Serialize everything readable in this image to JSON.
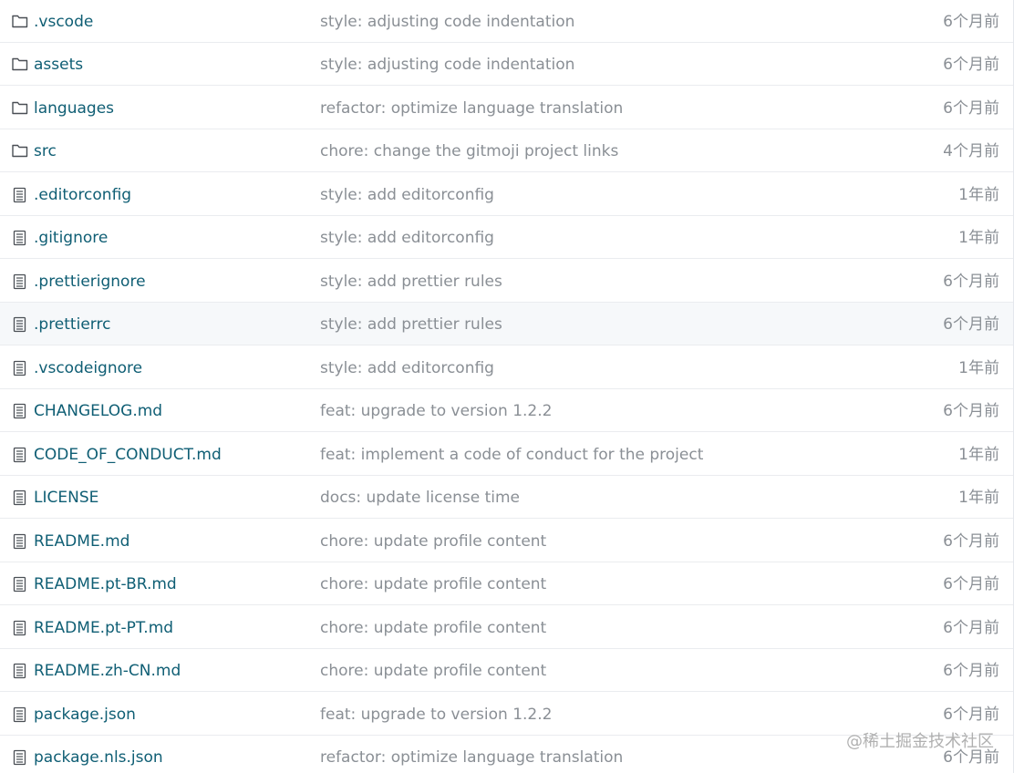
{
  "colors": {
    "file_link": "#0f5e74",
    "muted_text": "#8a8f95",
    "row_border": "#eaecef",
    "row_hover": "#f6f8fa"
  },
  "files": [
    {
      "type": "folder",
      "icon": "folder-icon",
      "name": ".vscode",
      "message": "style: adjusting code indentation",
      "time": "6个月前"
    },
    {
      "type": "folder",
      "icon": "folder-icon",
      "name": "assets",
      "message": "style: adjusting code indentation",
      "time": "6个月前"
    },
    {
      "type": "folder",
      "icon": "folder-icon",
      "name": "languages",
      "message": "refactor: optimize language translation",
      "time": "6个月前"
    },
    {
      "type": "folder",
      "icon": "folder-icon",
      "name": "src",
      "message": "chore: change the gitmoji project links",
      "time": "4个月前"
    },
    {
      "type": "file",
      "icon": "file-icon",
      "name": ".editorconfig",
      "message": "style: add editorconfig",
      "time": "1年前"
    },
    {
      "type": "file",
      "icon": "file-icon",
      "name": ".gitignore",
      "message": "style: add editorconfig",
      "time": "1年前"
    },
    {
      "type": "file",
      "icon": "file-icon",
      "name": ".prettierignore",
      "message": "style: add prettier rules",
      "time": "6个月前"
    },
    {
      "type": "file",
      "icon": "file-icon",
      "name": ".prettierrc",
      "message": "style: add prettier rules",
      "time": "6个月前"
    },
    {
      "type": "file",
      "icon": "file-icon",
      "name": ".vscodeignore",
      "message": "style: add editorconfig",
      "time": "1年前"
    },
    {
      "type": "file",
      "icon": "file-icon",
      "name": "CHANGELOG.md",
      "message": "feat: upgrade to version 1.2.2",
      "time": "6个月前"
    },
    {
      "type": "file",
      "icon": "file-icon",
      "name": "CODE_OF_CONDUCT.md",
      "message": "feat: implement a code of conduct for the project",
      "time": "1年前"
    },
    {
      "type": "file",
      "icon": "file-icon",
      "name": "LICENSE",
      "message": "docs: update license time",
      "time": "1年前"
    },
    {
      "type": "file",
      "icon": "file-icon",
      "name": "README.md",
      "message": "chore: update profile content",
      "time": "6个月前"
    },
    {
      "type": "file",
      "icon": "file-icon",
      "name": "README.pt-BR.md",
      "message": "chore: update profile content",
      "time": "6个月前"
    },
    {
      "type": "file",
      "icon": "file-icon",
      "name": "README.pt-PT.md",
      "message": "chore: update profile content",
      "time": "6个月前"
    },
    {
      "type": "file",
      "icon": "file-icon",
      "name": "README.zh-CN.md",
      "message": "chore: update profile content",
      "time": "6个月前"
    },
    {
      "type": "file",
      "icon": "file-icon",
      "name": "package.json",
      "message": "feat: upgrade to version 1.2.2",
      "time": "6个月前"
    },
    {
      "type": "file",
      "icon": "file-icon",
      "name": "package.nls.json",
      "message": "refactor: optimize language translation",
      "time": "6个月前"
    }
  ],
  "watermark": "@稀土掘金技术社区"
}
